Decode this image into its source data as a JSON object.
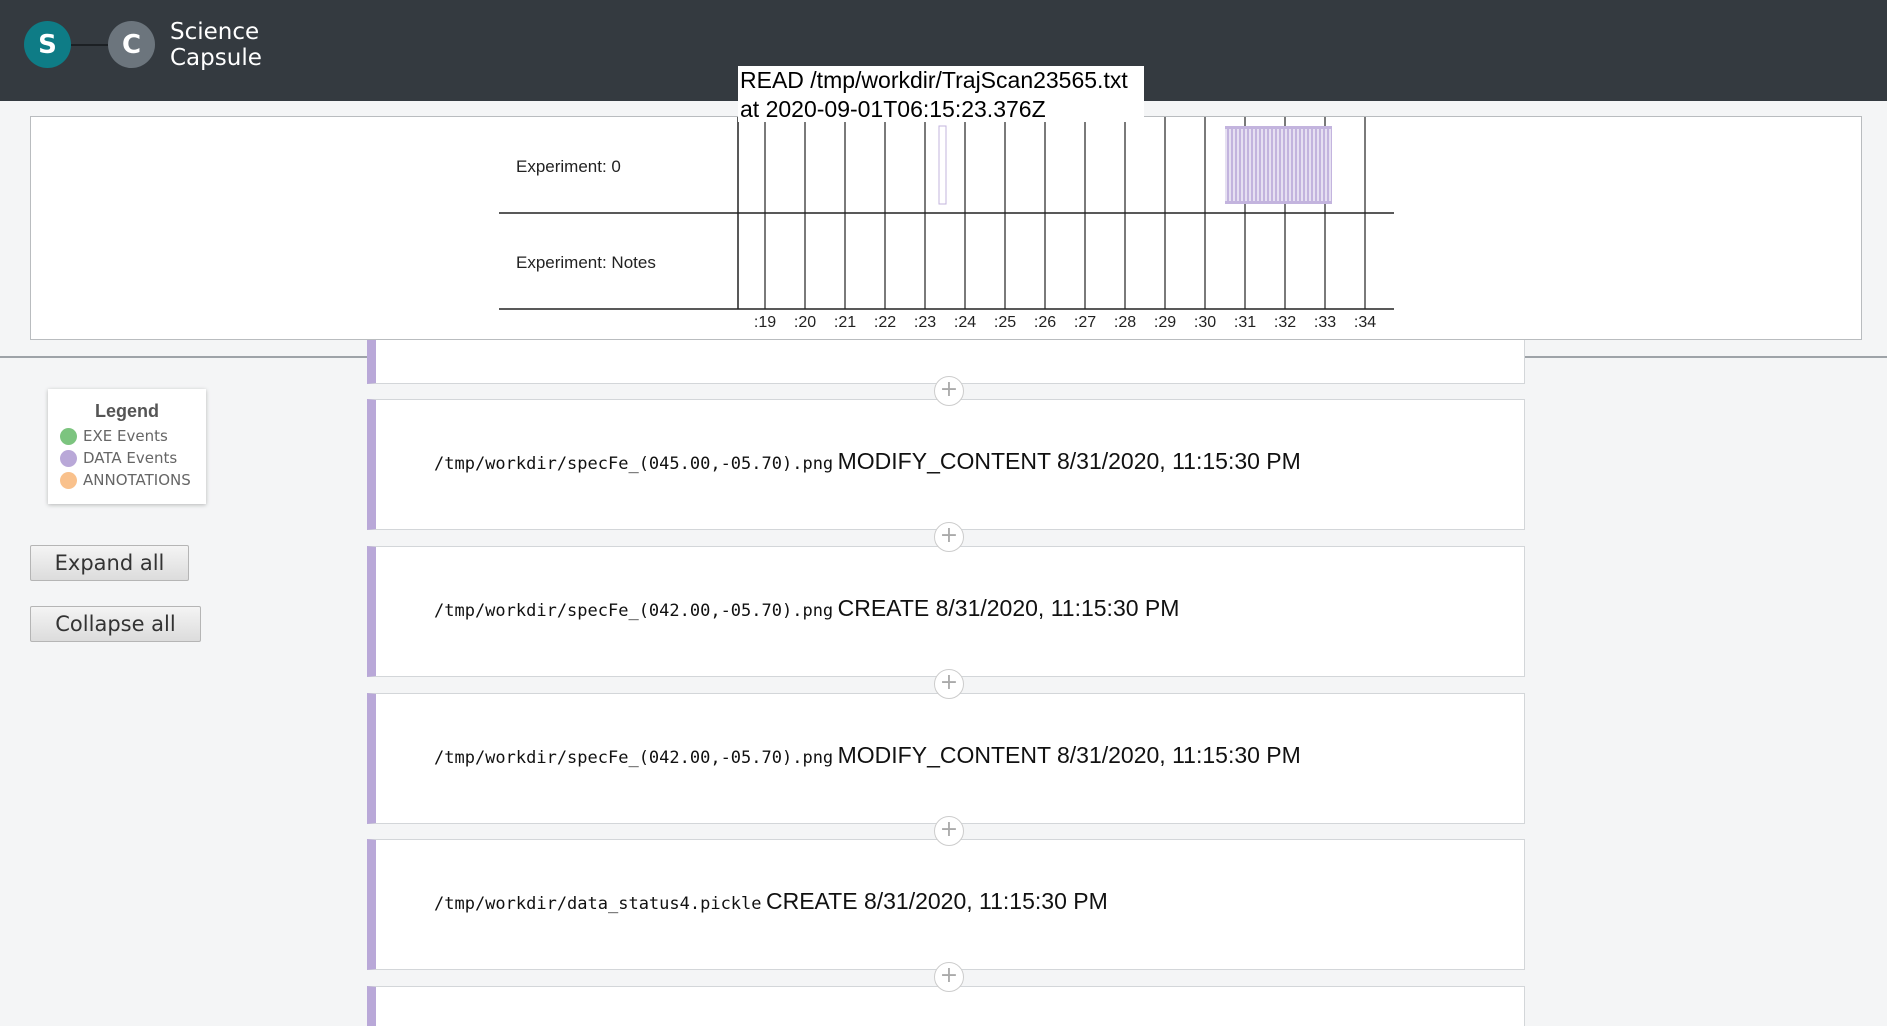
{
  "brand": {
    "logo_s": "S",
    "logo_c": "C",
    "line1": "Science",
    "line2": "Capsule"
  },
  "tooltip": {
    "line1": "READ /tmp/workdir/TrajScan23565.txt",
    "line2": "at 2020-09-01T06:15:23.376Z"
  },
  "timeline": {
    "rows": [
      "Experiment: 0",
      "Experiment: Notes"
    ],
    "ticks": [
      ":19",
      ":20",
      ":21",
      ":22",
      ":23",
      ":24",
      ":25",
      ":26",
      ":27",
      ":28",
      ":29",
      ":30",
      ":31",
      ":32",
      ":33",
      ":34"
    ],
    "event_color": "#c3b4de"
  },
  "legend": {
    "title": "Legend",
    "items": [
      {
        "label": "EXE Events",
        "color": "#7cc47f"
      },
      {
        "label": "DATA Events",
        "color": "#b9a8d8"
      },
      {
        "label": "ANNOTATIONS",
        "color": "#f9c18c"
      }
    ]
  },
  "buttons": {
    "expand": "Expand all",
    "collapse": "Collapse all"
  },
  "events": [
    {
      "path": "/tmp/workdir/specFe_(045.00,-05.70).png",
      "info": "MODIFY_CONTENT 8/31/2020, 11:15:30 PM"
    },
    {
      "path": "/tmp/workdir/specFe_(042.00,-05.70).png",
      "info": "CREATE 8/31/2020, 11:15:30 PM"
    },
    {
      "path": "/tmp/workdir/specFe_(042.00,-05.70).png",
      "info": "MODIFY_CONTENT 8/31/2020, 11:15:30 PM"
    },
    {
      "path": "/tmp/workdir/data_status4.pickle",
      "info": "CREATE 8/31/2020, 11:15:30 PM"
    }
  ],
  "plus_symbol": "+"
}
